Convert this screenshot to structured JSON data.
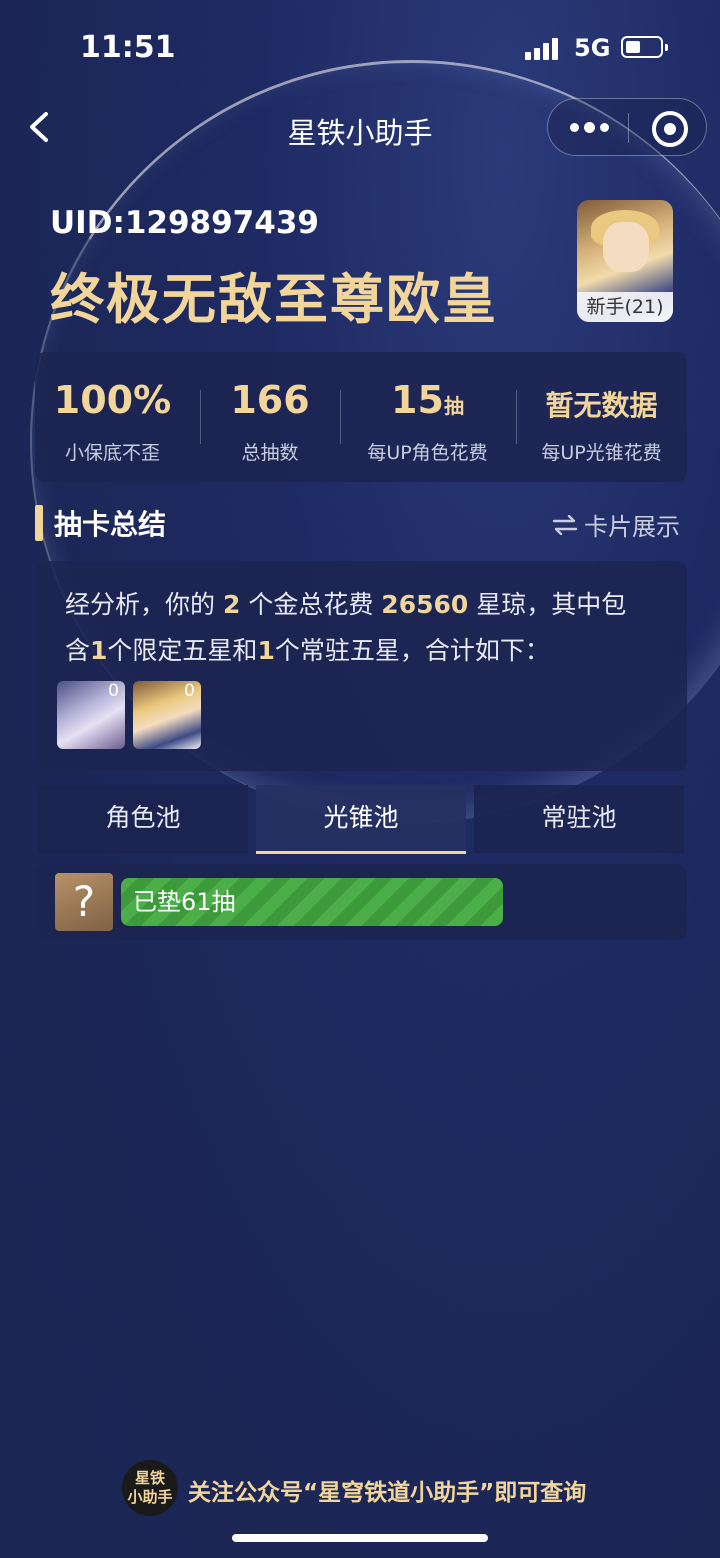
{
  "status_bar": {
    "time": "11:51",
    "network": "5G"
  },
  "nav": {
    "title": "星铁小助手"
  },
  "profile": {
    "uid": "UID:129897439",
    "rank_title": "终极无敌至尊欧皇",
    "avatar_level": "新手(21)"
  },
  "stats": [
    {
      "value": "100%",
      "unit": "",
      "label": "小保底不歪"
    },
    {
      "value": "166",
      "unit": "",
      "label": "总抽数"
    },
    {
      "value": "15",
      "unit": "抽",
      "label": "每UP角色花费"
    },
    {
      "value": "暂无数据",
      "unit": "",
      "label": "每UP光锥花费"
    }
  ],
  "section": {
    "title": "抽卡总结",
    "toggle_label": "卡片展示"
  },
  "summary": {
    "p1": "经分析，你的",
    "gold_count": "2",
    "p2": "个金总花费",
    "cost": "26560",
    "p3": "星琼，其中包",
    "p4": "含",
    "limited_count": "1",
    "p5": "个限定五星和",
    "standard_count": "1",
    "p6": "个常驻五星，合计如下：",
    "thumbs": [
      {
        "count": "0"
      },
      {
        "count": "0"
      }
    ]
  },
  "tabs": [
    {
      "label": "角色池",
      "active": false
    },
    {
      "label": "光锥池",
      "active": true
    },
    {
      "label": "常驻池",
      "active": false
    }
  ],
  "pity": {
    "unknown_icon": "?",
    "label": "已垫61抽",
    "progress_ratio": 0.61
  },
  "footer": {
    "logo_line1": "星铁",
    "logo_line2": "小助手",
    "text": "关注公众号“星穹铁道小助手”即可查询"
  },
  "colors": {
    "accent_gold": "#f1d59a",
    "progress_green": "#4cae48",
    "background": "#1e2a62"
  }
}
